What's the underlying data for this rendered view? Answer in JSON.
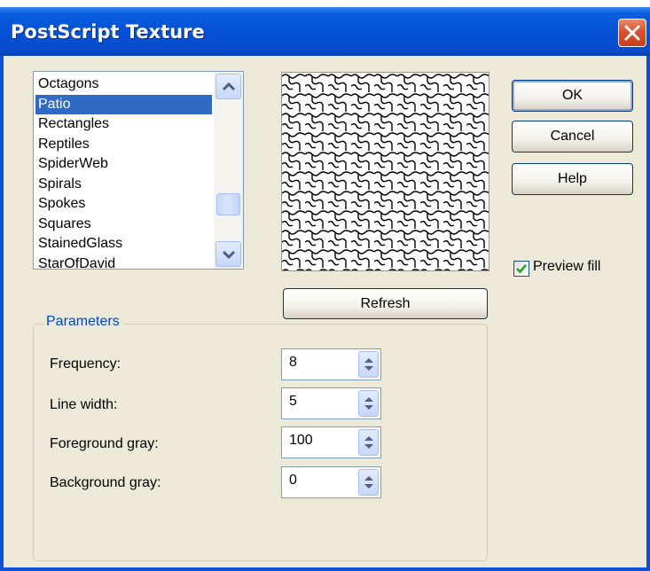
{
  "window": {
    "title": "PostScript Texture"
  },
  "texture_list": {
    "items": [
      "Octagons",
      "Patio",
      "Rectangles",
      "Reptiles",
      "SpiderWeb",
      "Spirals",
      "Spokes",
      "Squares",
      "StainedGlass",
      "StarOfDavid"
    ],
    "selected": "Patio"
  },
  "buttons": {
    "ok": "OK",
    "cancel": "Cancel",
    "help": "Help",
    "refresh": "Refresh"
  },
  "preview_fill": {
    "label": "Preview fill",
    "checked": true
  },
  "parameters": {
    "group_label": "Parameters",
    "frequency": {
      "label": "Frequency:",
      "value": "8"
    },
    "line_width": {
      "label": "Line width:",
      "value": "5"
    },
    "foreground_gray": {
      "label": "Foreground gray:",
      "value": "100"
    },
    "background_gray": {
      "label": "Background gray:",
      "value": "0"
    }
  },
  "colors": {
    "titlebar": "#0551d6",
    "dialog_face": "#ece9d8",
    "selection": "#316ac5",
    "group_label": "#0046d5",
    "close_button": "#d9512c"
  },
  "icons": [
    "close-icon",
    "scroll-up-arrow-icon",
    "scroll-down-arrow-icon",
    "checkmark-icon",
    "spin-arrows-icon"
  ]
}
